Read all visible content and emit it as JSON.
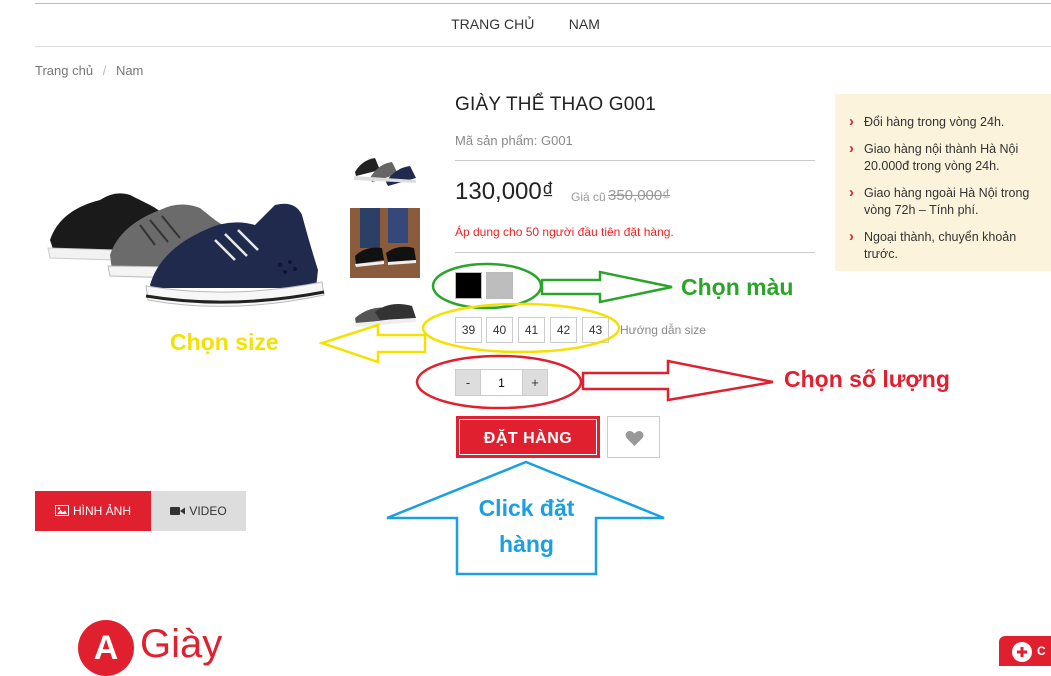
{
  "nav": {
    "home": "TRANG CHỦ",
    "men": "NAM"
  },
  "breadcrumb": {
    "home": "Trang chủ",
    "sep": "/",
    "current": "Nam"
  },
  "product": {
    "title": "GIÀY THỂ THAO G001",
    "sku": "Mã sản phẩm: G001",
    "price": "130,000₫",
    "old_price_label": "Giá cũ",
    "old_price": "350,000₫",
    "promo": "Áp dụng cho 50 người đầu tiên đặt hàng.",
    "colors": [
      "#000000",
      "#bdbdbd"
    ],
    "sizes": [
      "39",
      "40",
      "41",
      "42",
      "43"
    ],
    "size_guide": "Hướng dẫn size",
    "qty_minus": "-",
    "qty_value": "1",
    "qty_plus": "+",
    "order_button": "ĐẶT HÀNG"
  },
  "info": {
    "items": [
      "Đổi hàng trong vòng 24h.",
      "Giao hàng nội thành Hà Nội 20.000đ trong vòng 24h.",
      "Giao hàng ngoài Hà Nội trong vòng 72h – Tính phí.",
      "Ngoại thành, chuyển khoản trước."
    ]
  },
  "media_tabs": {
    "images": "HÌNH ẢNH",
    "video": "VIDEO"
  },
  "annotations": {
    "color": "Chọn màu",
    "size": "Chọn size",
    "quantity": "Chọn số lượng",
    "order_line1": "Click đặt",
    "order_line2": "hàng"
  },
  "logo": {
    "letter": "A",
    "text": "Giày"
  },
  "chat": {
    "label": "C"
  },
  "colors": {
    "accent": "#e0202e",
    "green": "#2aa52a",
    "yellow": "#f5e100",
    "red": "#e0202e",
    "blue": "#1aa0e0"
  }
}
